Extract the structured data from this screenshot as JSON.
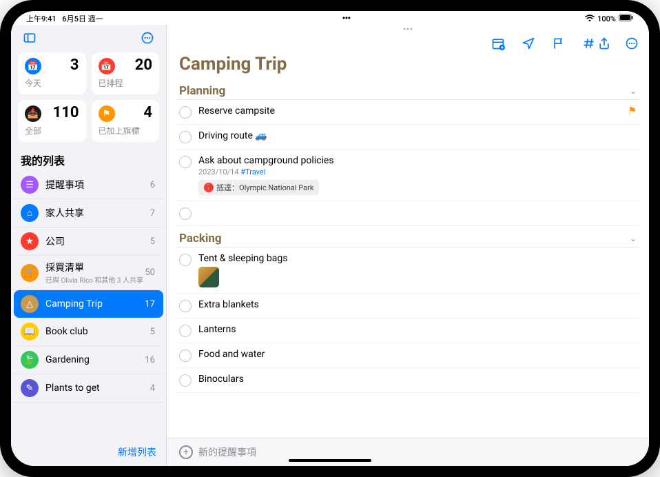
{
  "status": {
    "time": "上午9:41",
    "date": "6月5日 週一",
    "wifi": "􀙇",
    "battery": "100%"
  },
  "sidebar": {
    "cards": [
      {
        "label": "今天",
        "count": "3",
        "color": "blue",
        "glyph": "📅"
      },
      {
        "label": "已排程",
        "count": "20",
        "color": "red",
        "glyph": "📅"
      },
      {
        "label": "全部",
        "count": "110",
        "color": "dark",
        "glyph": "📥"
      },
      {
        "label": "已加上旗標",
        "count": "4",
        "color": "orange",
        "glyph": "⚑"
      }
    ],
    "heading": "我的列表",
    "lists": [
      {
        "name": "提醒事項",
        "count": "6",
        "color": "#a259ff",
        "glyph": "☰"
      },
      {
        "name": "家人共享",
        "count": "7",
        "color": "#007aff",
        "glyph": "⌂"
      },
      {
        "name": "公司",
        "count": "5",
        "color": "#ff3b30",
        "glyph": "★"
      },
      {
        "name": "採買清單",
        "sub": "已與 Olivia Rico 和其他 3 人共享",
        "count": "50",
        "color": "#ff9500",
        "glyph": "🛒"
      },
      {
        "name": "Camping Trip",
        "count": "17",
        "color": "#ca9a50",
        "glyph": "△",
        "selected": true
      },
      {
        "name": "Book club",
        "count": "5",
        "color": "#ffcc00",
        "glyph": "📖"
      },
      {
        "name": "Gardening",
        "count": "16",
        "color": "#34c759",
        "glyph": "🍃"
      },
      {
        "name": "Plants to get",
        "count": "4",
        "color": "#5856d6",
        "glyph": "✎"
      }
    ],
    "new_list": "新增列表"
  },
  "main": {
    "title": "Camping Trip",
    "new_reminder": "新的提醒事項",
    "sections": [
      {
        "name": "Planning",
        "items": [
          {
            "title": "Reserve campsite",
            "flagged": true
          },
          {
            "title": "Driving route 🚙"
          },
          {
            "title": "Ask about campground policies",
            "date": "2023/10/14",
            "tag": "#Travel",
            "chip": "抵達：Olympic National Park"
          },
          {
            "title": ""
          }
        ]
      },
      {
        "name": "Packing",
        "items": [
          {
            "title": "Tent & sleeping bags",
            "thumb": true
          },
          {
            "title": "Extra blankets"
          },
          {
            "title": "Lanterns"
          },
          {
            "title": "Food and water"
          },
          {
            "title": "Binoculars"
          }
        ]
      }
    ]
  }
}
